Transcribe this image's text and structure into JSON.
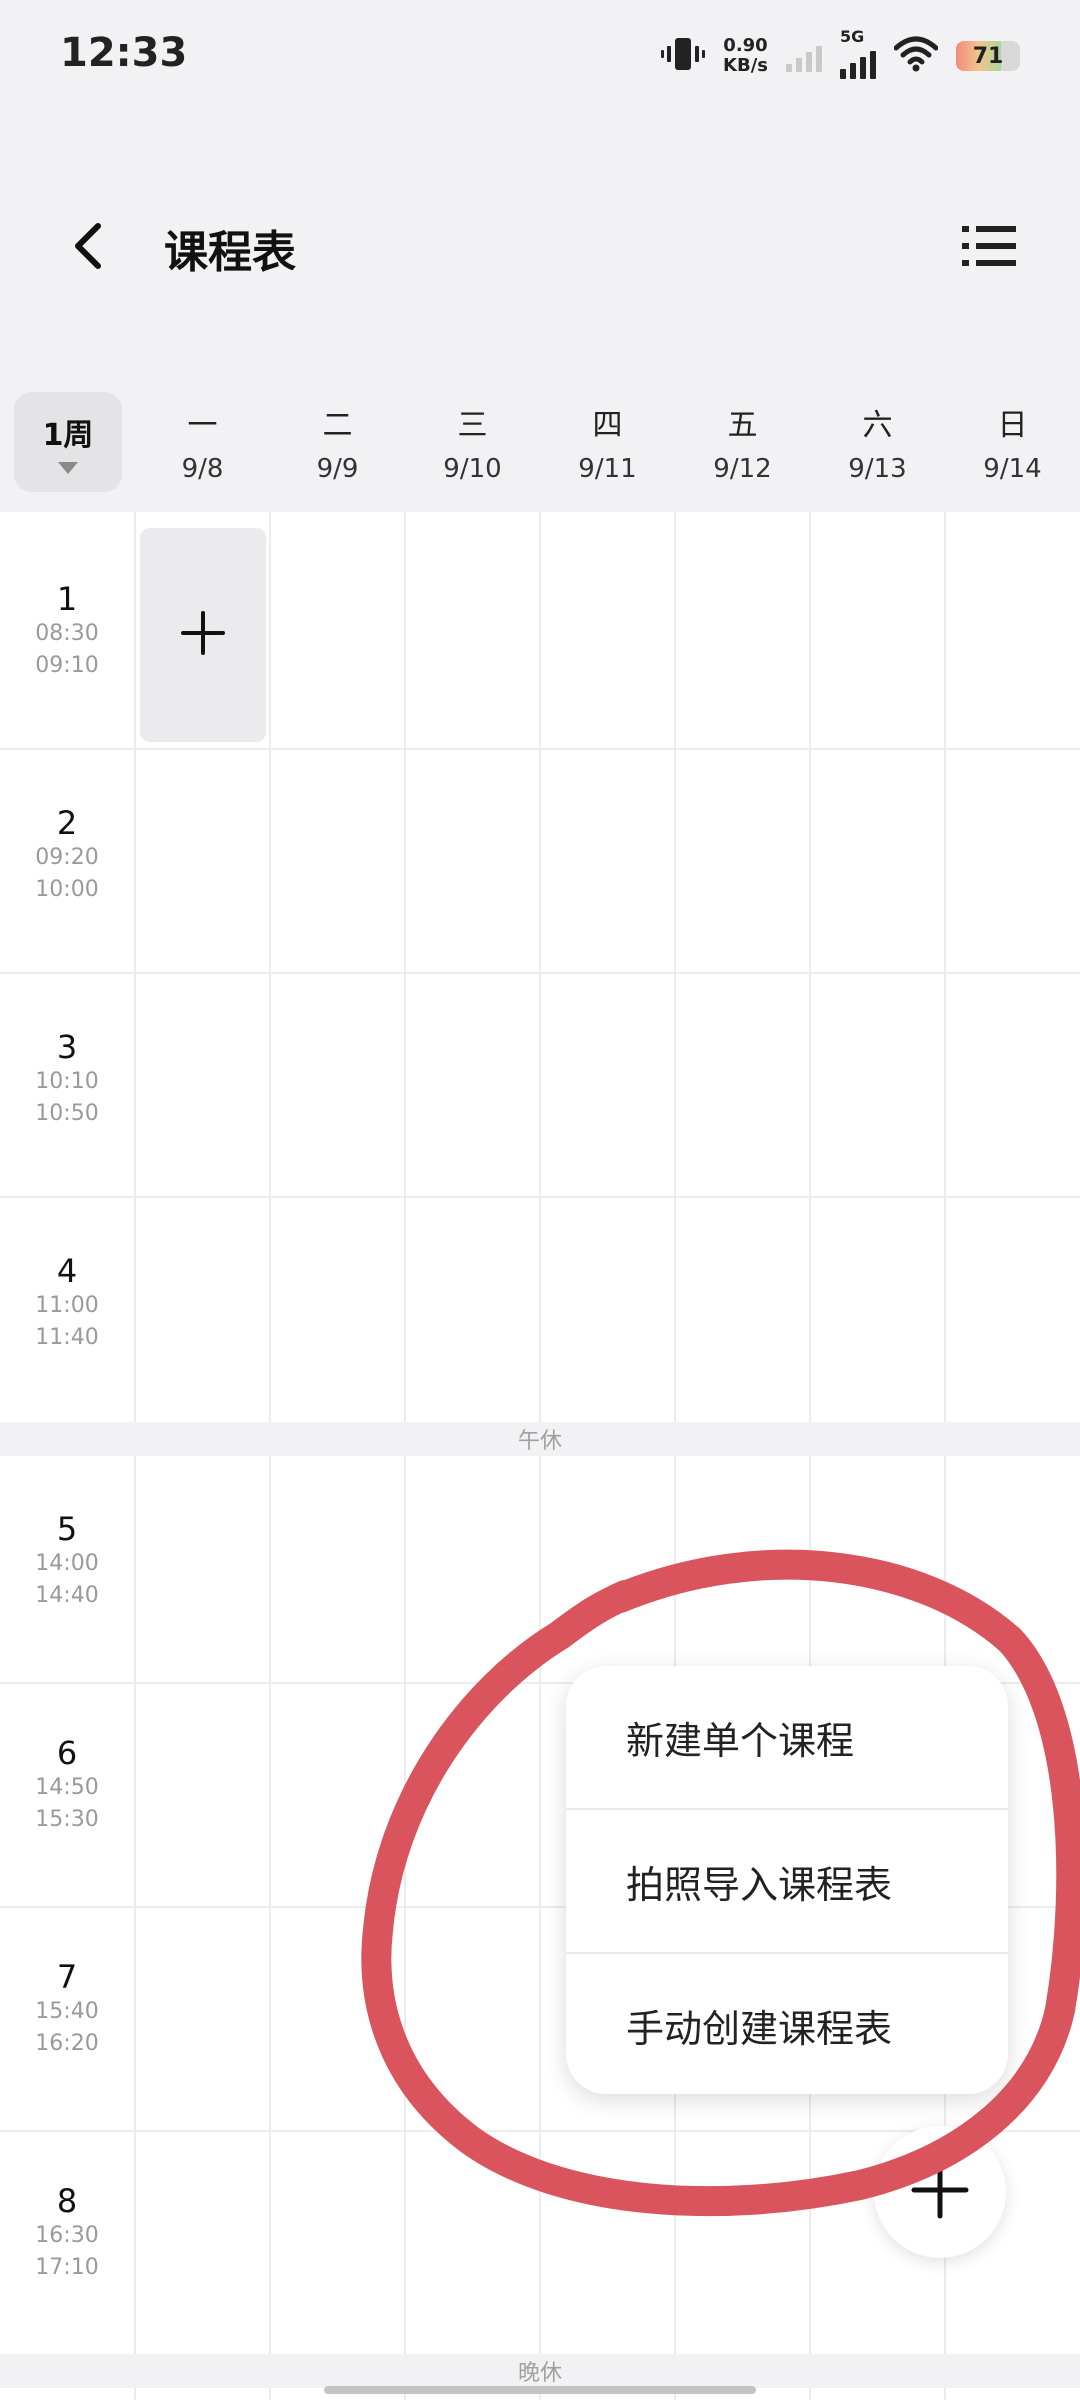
{
  "status_bar": {
    "time": "12:33",
    "net_speed_value": "0.90",
    "net_speed_unit": "KB/s",
    "network_type": "5G",
    "battery": "71"
  },
  "header": {
    "title": "课程表"
  },
  "week_selector": {
    "label": "1周"
  },
  "days": [
    {
      "name": "一",
      "date": "9/8"
    },
    {
      "name": "二",
      "date": "9/9"
    },
    {
      "name": "三",
      "date": "9/10"
    },
    {
      "name": "四",
      "date": "9/11"
    },
    {
      "name": "五",
      "date": "9/12"
    },
    {
      "name": "六",
      "date": "9/13"
    },
    {
      "name": "日",
      "date": "9/14"
    }
  ],
  "periods": [
    {
      "num": "1",
      "start": "08:30",
      "end": "09:10"
    },
    {
      "num": "2",
      "start": "09:20",
      "end": "10:00"
    },
    {
      "num": "3",
      "start": "10:10",
      "end": "10:50"
    },
    {
      "num": "4",
      "start": "11:00",
      "end": "11:40"
    },
    {
      "num": "5",
      "start": "14:00",
      "end": "14:40"
    },
    {
      "num": "6",
      "start": "14:50",
      "end": "15:30"
    },
    {
      "num": "7",
      "start": "15:40",
      "end": "16:20"
    },
    {
      "num": "8",
      "start": "16:30",
      "end": "17:10"
    }
  ],
  "breaks": {
    "noon": "午休",
    "evening": "晚休"
  },
  "popup_menu": {
    "items": [
      "新建单个课程",
      "拍照导入课程表",
      "手动创建课程表"
    ]
  },
  "colors": {
    "background": "#f2f2f4",
    "annotation_red": "#d9545c",
    "grid_line": "#ececee"
  },
  "icons": {
    "back": "chevron-left-icon",
    "menu": "list-icon",
    "add": "plus-icon"
  }
}
